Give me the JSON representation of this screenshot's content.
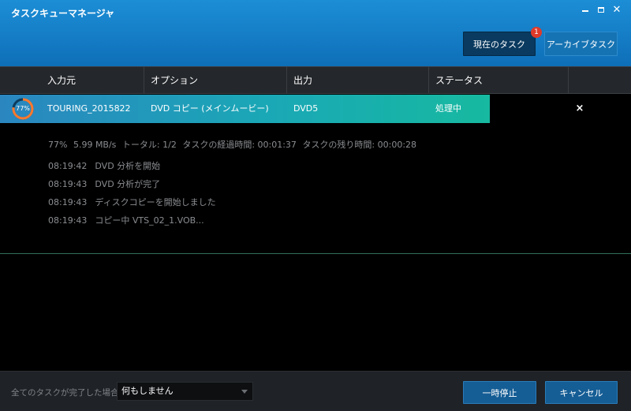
{
  "window": {
    "title": "タスクキューマネージャ",
    "close_glyph": "✕"
  },
  "top_buttons": {
    "current_label": "現在のタスク",
    "current_badge": "1",
    "archive_label": "アーカイブタスク"
  },
  "columns": [
    "入力元",
    "オプション",
    "出力",
    "ステータス"
  ],
  "task": {
    "progress_percent": 77,
    "progress_text": "77%",
    "source": "TOURING_2015822",
    "option": "DVD コピー (メインムービー)",
    "output": "DVD5",
    "status": "処理中",
    "remove_glyph": "×"
  },
  "details": {
    "percent": "77%",
    "speed": "5.99 MB/s",
    "total": "トータル: 1/2",
    "elapsed": "タスクの経過時間: 00:01:37",
    "remaining": "タスクの残り時間: 00:00:28",
    "log": [
      {
        "time": "08:19:42",
        "message": "DVD 分析を開始"
      },
      {
        "time": "08:19:43",
        "message": "DVD 分析が完了"
      },
      {
        "time": "08:19:43",
        "message": "ディスクコピーを開始しました"
      },
      {
        "time": "08:19:43",
        "message": "コピー中 VTS_02_1.VOB..."
      }
    ]
  },
  "footer": {
    "label": "全てのタスクが完了した場合:",
    "select_value": "何もしません",
    "pause_label": "一時停止",
    "cancel_label": "キャンセル"
  },
  "colors": {
    "titlebar": "#1479c4",
    "progress_fill": "#1aa8b6",
    "status_green": "#17b9a0",
    "badge": "#e03a2a"
  }
}
